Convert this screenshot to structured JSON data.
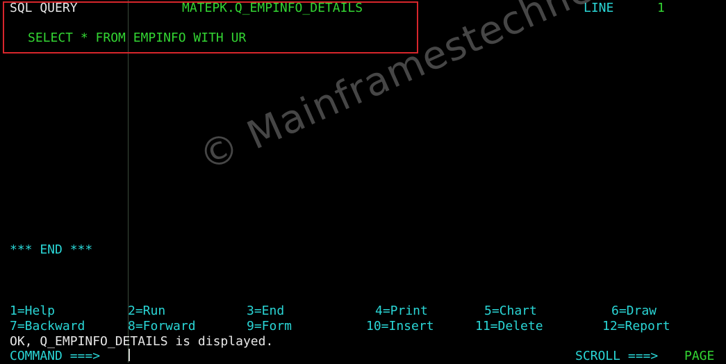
{
  "header": {
    "panel_label": "SQL QUERY",
    "query_name": "MATEPK.Q_EMPINFO_DETAILS",
    "line_label": "LINE",
    "line_number": "1"
  },
  "query": {
    "sql_text": "SELECT * FROM EMPINFO WITH UR"
  },
  "end_marker": "*** END ***",
  "function_keys": {
    "row1": [
      "1=Help",
      "2=Run",
      "3=End",
      "4=Print",
      "5=Chart",
      "6=Draw"
    ],
    "row2": [
      "7=Backward",
      "8=Forward",
      "9=Form",
      "10=Insert",
      "11=Delete",
      "12=Report"
    ]
  },
  "message": "OK, Q_EMPINFO_DETAILS is displayed.",
  "command": {
    "label": "COMMAND ===>",
    "value": ""
  },
  "scroll": {
    "label": "SCROLL ===>",
    "value": "PAGE"
  },
  "watermark": "© Mainframestechhelp",
  "colors": {
    "background": "#000000",
    "text_white": "#e8e8e8",
    "text_green": "#33d633",
    "text_cyan": "#2ad6d6",
    "highlight_border": "#d8262c"
  }
}
